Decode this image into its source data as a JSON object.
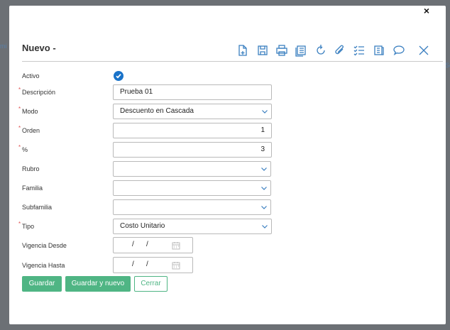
{
  "background": {
    "left_hint": "mi",
    "right_hint": "Se"
  },
  "outer_close_label": "×",
  "dialog": {
    "title": "Nuevo -",
    "toolbar_icons": [
      "new-document-icon",
      "save-icon",
      "print-icon",
      "copy-icon",
      "refresh-icon",
      "attach-icon",
      "checklist-icon",
      "report-icon",
      "comment-icon",
      "close-icon"
    ]
  },
  "form": {
    "activo": {
      "label": "Activo",
      "checked": true
    },
    "descripcion": {
      "label": "Descripción",
      "value": "Prueba 01",
      "required": "*"
    },
    "modo": {
      "label": "Modo",
      "value": "Descuento en Cascada",
      "required": "*"
    },
    "orden": {
      "label": "Orden",
      "value": "1",
      "required": "*"
    },
    "porcentaje": {
      "label": "%",
      "value": "3",
      "required": "*"
    },
    "rubro": {
      "label": "Rubro",
      "value": ""
    },
    "familia": {
      "label": "Familia",
      "value": ""
    },
    "subfamilia": {
      "label": "Subfamilia",
      "value": ""
    },
    "tipo": {
      "label": "Tipo",
      "value": "Costo Unitario",
      "required": "*"
    },
    "vigencia_desde": {
      "label": "Vigencia Desde",
      "sep": "/"
    },
    "vigencia_hasta": {
      "label": "Vigencia Hasta",
      "sep": "/"
    }
  },
  "buttons": {
    "guardar": "Guardar",
    "guardar_y_nuevo": "Guardar y nuevo",
    "cerrar": "Cerrar"
  },
  "colors": {
    "accent": "#4fb584",
    "check": "#1a73c9",
    "icon": "#3a7fc0",
    "required": "#e05252"
  }
}
